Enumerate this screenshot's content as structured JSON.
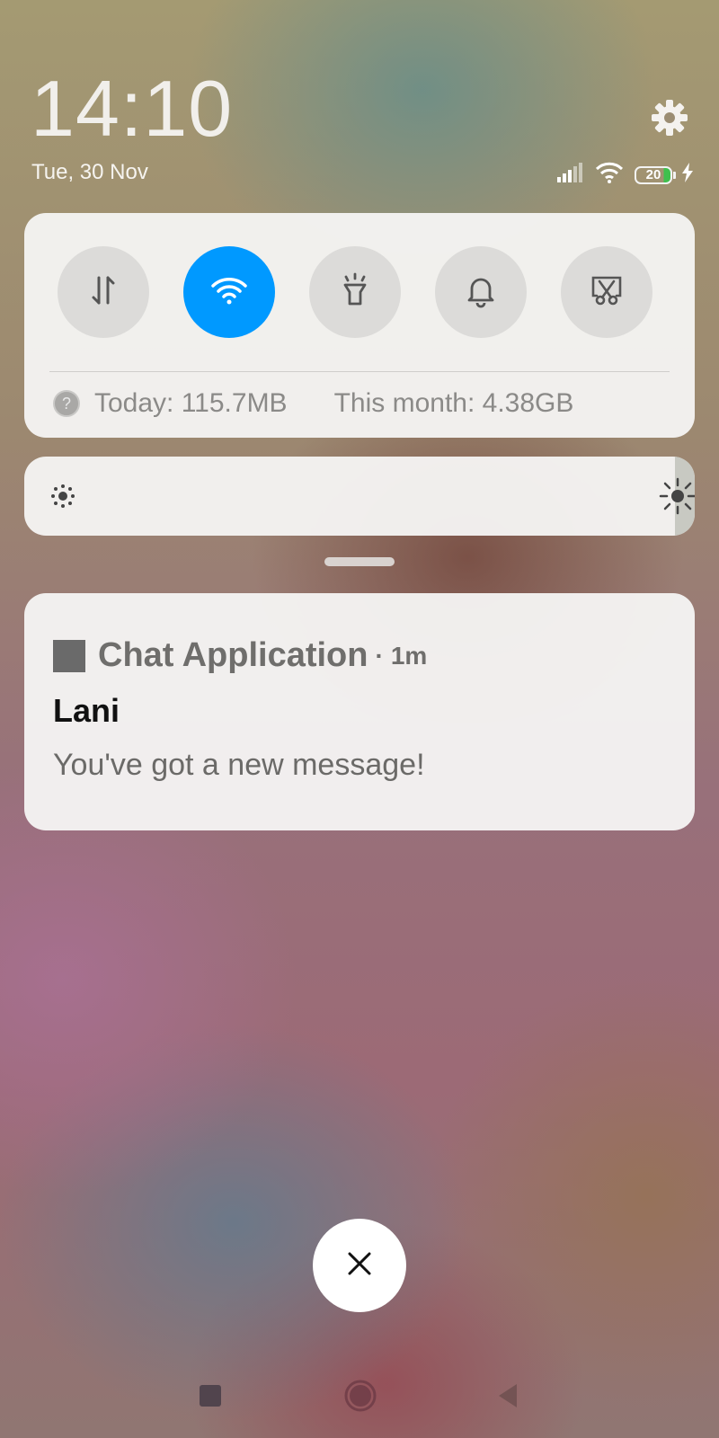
{
  "status_bar": {
    "time": "14:10",
    "date": "Tue, 30 Nov",
    "battery_level": "20",
    "icons": [
      "signal-icon",
      "wifi-icon",
      "battery-icon",
      "charging-icon",
      "gear-icon"
    ]
  },
  "quick_settings": {
    "toggles": [
      {
        "name": "mobile-data-toggle",
        "icon": "data-transfer-icon",
        "active": false
      },
      {
        "name": "wifi-toggle",
        "icon": "wifi-icon",
        "active": true
      },
      {
        "name": "flashlight-toggle",
        "icon": "flashlight-icon",
        "active": false
      },
      {
        "name": "sound-toggle",
        "icon": "bell-icon",
        "active": false
      },
      {
        "name": "screenshot-toggle",
        "icon": "screenshot-scissors-icon",
        "active": false
      }
    ],
    "data_usage": {
      "today": "Today: 115.7MB",
      "month": "This month: 4.38GB"
    },
    "accent_color": "#0099ff"
  },
  "brightness": {
    "level": 0.97
  },
  "notification": {
    "app_name": "Chat Application",
    "separator": "·",
    "time": "1m",
    "title": "Lani",
    "message": "You've got a new message!"
  },
  "dismiss": {
    "icon": "close-icon"
  },
  "nav_bar": {
    "icons": [
      "recents-square-icon",
      "home-circle-icon",
      "back-triangle-icon"
    ]
  }
}
